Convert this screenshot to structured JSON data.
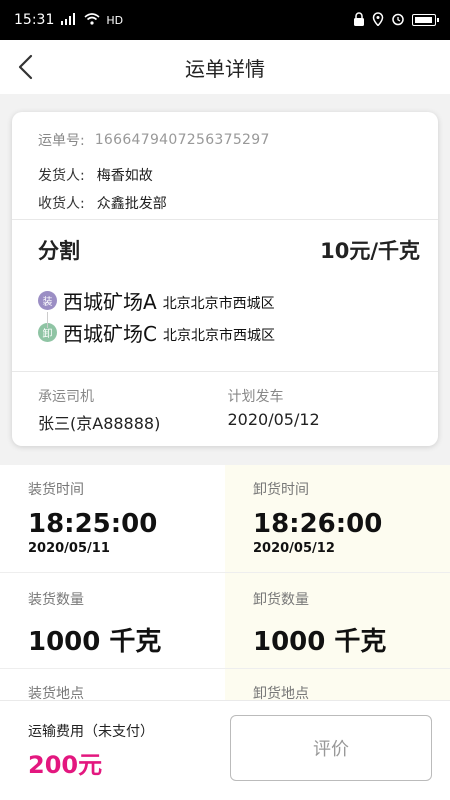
{
  "status_bar": {
    "time": "15:31",
    "network": "4G",
    "hd": "HD"
  },
  "header": {
    "title": "运单详情"
  },
  "waybill": {
    "number_label": "运单号:",
    "number": "1666479407256375297",
    "shipper_label": "发货人:",
    "shipper": "梅香如故",
    "consignee_label": "收货人:",
    "consignee": "众鑫批发部"
  },
  "cargo": {
    "name": "分割",
    "price": "10元/千克"
  },
  "route": {
    "load_badge": "装",
    "load_place": "西城矿场A",
    "load_address": "北京北京市西城区",
    "unload_badge": "卸",
    "unload_place": "西城矿场C",
    "unload_address": "北京北京市西城区"
  },
  "trip": {
    "driver_label": "承运司机",
    "driver": "张三(京A88888)",
    "plan_label": "计划发车",
    "plan_date": "2020/05/12"
  },
  "details": {
    "load_time_label": "装货时间",
    "load_time": "18:25:00",
    "load_date": "2020/05/11",
    "unload_time_label": "卸货时间",
    "unload_time": "18:26:00",
    "unload_date": "2020/05/12",
    "load_qty_label": "装货数量",
    "load_qty": "1000 千克",
    "unload_qty_label": "卸货数量",
    "unload_qty": "1000 千克",
    "load_place_label": "装货地点",
    "unload_place_label": "卸货地点"
  },
  "footer": {
    "fee_label": "运输费用（未支付）",
    "fee": "200元",
    "rate_button": "评价"
  },
  "colors": {
    "fee": "#e3177f",
    "load_badge": "#9b8ec4",
    "unload_badge": "#8fc4a4",
    "right_column_bg": "#fdfcf0"
  }
}
